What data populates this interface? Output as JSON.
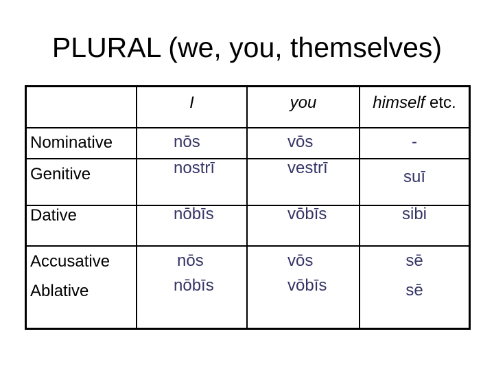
{
  "title": "PLURAL (we, you, themselves)",
  "table": {
    "headers": [
      {
        "italic": "",
        "plain": ""
      },
      {
        "italic": "I",
        "plain": ""
      },
      {
        "italic": "you",
        "plain": ""
      },
      {
        "italic": "himself",
        "plain": " etc."
      }
    ],
    "rows": [
      {
        "case": "Nominative",
        "values": [
          "nōs",
          "vōs",
          "-"
        ]
      },
      {
        "case": "Genitive",
        "values": [
          "nostrī",
          "vestrī",
          "suī"
        ]
      },
      {
        "case": "Dative",
        "values": [
          "nōbīs",
          "vōbīs",
          "sibi"
        ]
      },
      {
        "case": "Accusative",
        "values": [
          "nōs",
          "vōs",
          "sē"
        ]
      },
      {
        "case": "Ablative",
        "values": [
          "nōbīs",
          "vōbīs",
          "sē"
        ]
      }
    ]
  },
  "colors": {
    "value_text": "#333366",
    "label_text": "#000000"
  }
}
